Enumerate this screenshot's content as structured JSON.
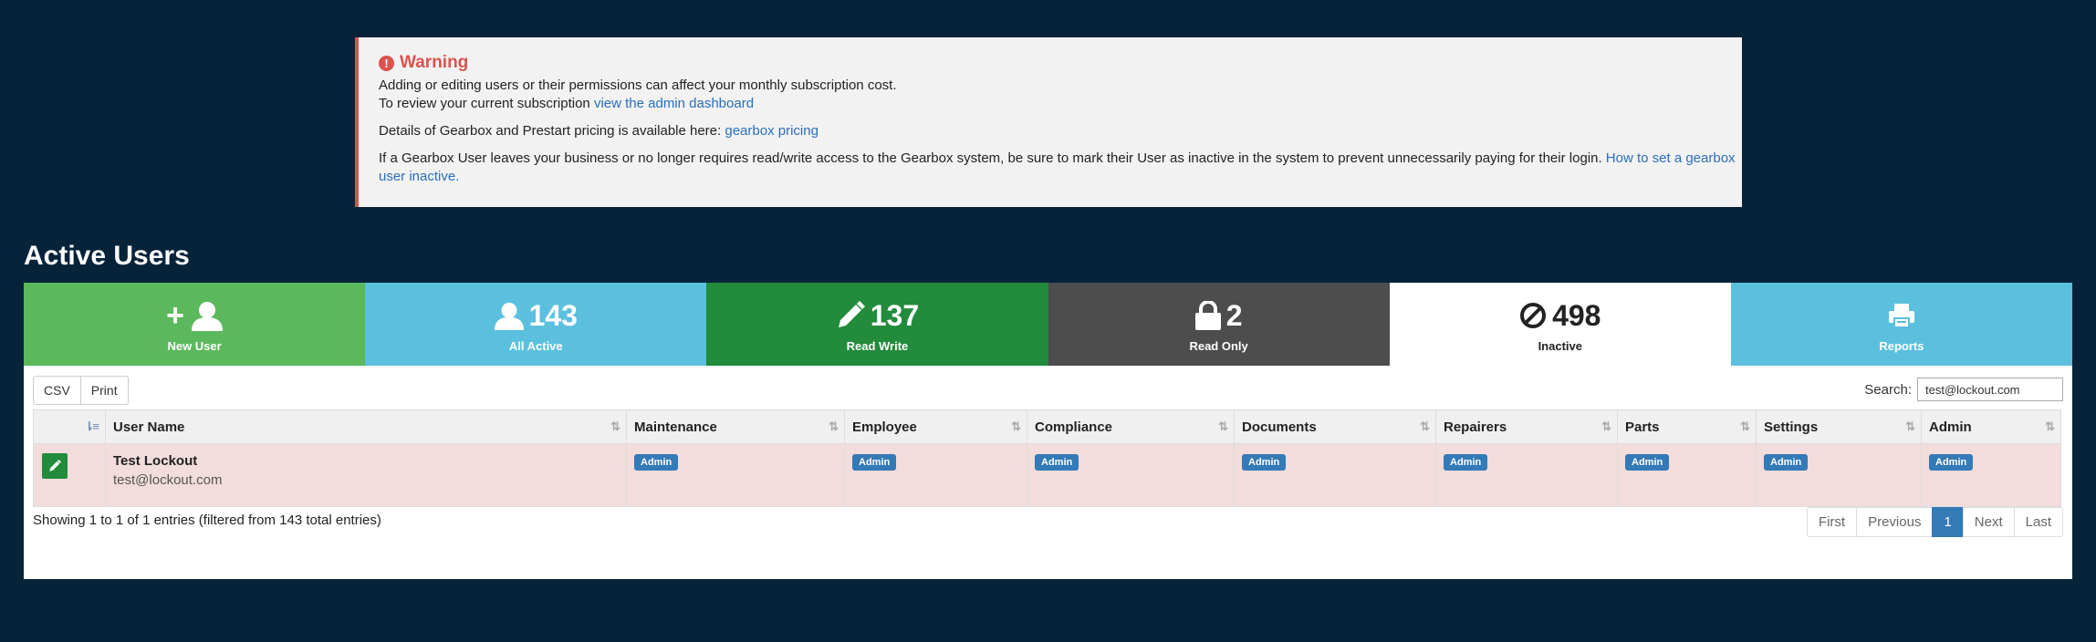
{
  "warning": {
    "title": "Warning",
    "line1": "Adding or editing users or their permissions can affect your monthly subscription cost.",
    "line2_text": "To review your current subscription ",
    "line2_link": "view the admin dashboard",
    "line3_text": "Details of Gearbox and Prestart pricing is available here: ",
    "line3_link": "gearbox pricing",
    "line4_text": "If a Gearbox User leaves your business or no longer requires read/write access to the Gearbox system, be sure to mark their User as inactive in the system to prevent unnecessarily paying for their login. ",
    "line4_link": "How to set a gearbox user inactive."
  },
  "page_title": "Active Users",
  "tiles": {
    "new_user": {
      "label": "New User",
      "plus": "+"
    },
    "all_active": {
      "count": "143",
      "label": "All Active"
    },
    "read_write": {
      "count": "137",
      "label": "Read Write"
    },
    "read_only": {
      "count": "2",
      "label": "Read Only"
    },
    "inactive": {
      "count": "498",
      "label": "Inactive"
    },
    "reports": {
      "label": "Reports"
    }
  },
  "toolbar": {
    "csv_label": "CSV",
    "print_label": "Print"
  },
  "search": {
    "label": "Search:",
    "value": "test@lockout.com"
  },
  "table": {
    "headers": [
      "User Name",
      "Maintenance",
      "Employee",
      "Compliance",
      "Documents",
      "Repairers",
      "Parts",
      "Settings",
      "Admin"
    ],
    "row": {
      "name": "Test Lockout",
      "email": "test@lockout.com",
      "badges": [
        "Admin",
        "Admin",
        "Admin",
        "Admin",
        "Admin",
        "Admin",
        "Admin",
        "Admin"
      ]
    }
  },
  "info": "Showing 1 to 1 of 1 entries (filtered from 143 total entries)",
  "pager": {
    "first": "First",
    "previous": "Previous",
    "current": "1",
    "next": "Next",
    "last": "Last"
  },
  "colors": {
    "background": "#06233a",
    "new_user": "#5cb85c",
    "all_active": "#5bc0de",
    "read_write": "#228b3c",
    "read_only": "#4d4d4d",
    "inactive": "#ffffff",
    "reports": "#5bc0de",
    "warning_accent": "#d9534f",
    "badge": "#337ab7",
    "row_highlight": "#f2dcdc"
  }
}
